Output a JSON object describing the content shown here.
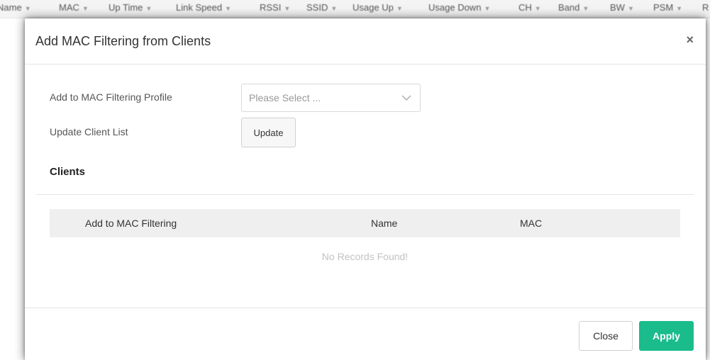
{
  "background_table": {
    "columns": [
      "Name",
      "MAC",
      "Up Time",
      "Link Speed",
      "RSSI",
      "SSID",
      "Usage Up",
      "Usage Down",
      "CH",
      "Band",
      "BW",
      "PSM",
      "R"
    ]
  },
  "modal": {
    "title": "Add MAC Filtering from Clients",
    "close_symbol": "×",
    "form": {
      "profile_label": "Add to MAC Filtering Profile",
      "profile_placeholder": "Please Select ...",
      "update_label": "Update Client List",
      "update_button": "Update"
    },
    "clients": {
      "section_title": "Clients",
      "columns": [
        "Add to MAC Filtering",
        "Name",
        "MAC"
      ],
      "empty_message": "No Records Found!"
    },
    "footer": {
      "close_button": "Close",
      "apply_button": "Apply"
    }
  },
  "colors": {
    "accent": "#1abc8c",
    "table_header_bg": "#efefef",
    "muted_text": "#c2c2c2"
  },
  "icons": {
    "select_arrow": "chevron-down-icon",
    "modal_close": "close-icon"
  }
}
